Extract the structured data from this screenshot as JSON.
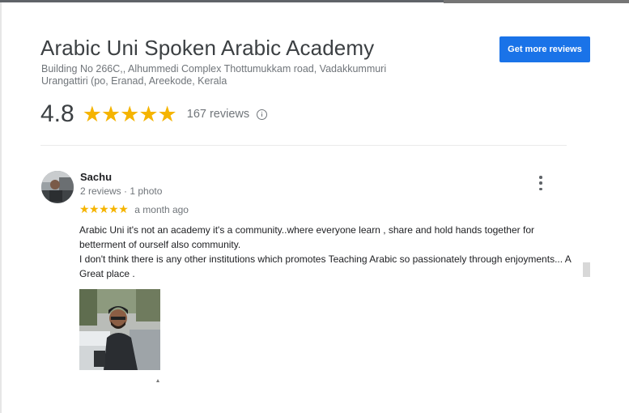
{
  "place": {
    "title": "Arabic Uni Spoken Arabic Academy",
    "address": "Building No 266C,, Alhummedi Complex Thottumukkam road, Vadakkummuri Urangattiri (po, Eranad, Areekode, Kerala",
    "rating": "4.8",
    "stars": "★★★★★",
    "review_count": "167 reviews",
    "star_color": "#f5b400"
  },
  "actions": {
    "more_reviews_label": "Get more reviews",
    "accent": "#1a73e8"
  },
  "icons": {
    "info": "info-icon",
    "more": "more-vert-icon"
  },
  "review": {
    "reviewer_name": "Sachu",
    "reviewer_meta": "2 reviews · 1 photo",
    "stars": "★★★★★",
    "time": "a month ago",
    "text_lines": [
      "Arabic Uni it's not an academy it's a community..where everyone learn , share and hold hands together for betterment of ourself also community.",
      "I don't think there is any other institutions which promotes Teaching Arabic so passionately through enjoyments... A Great place ."
    ]
  }
}
